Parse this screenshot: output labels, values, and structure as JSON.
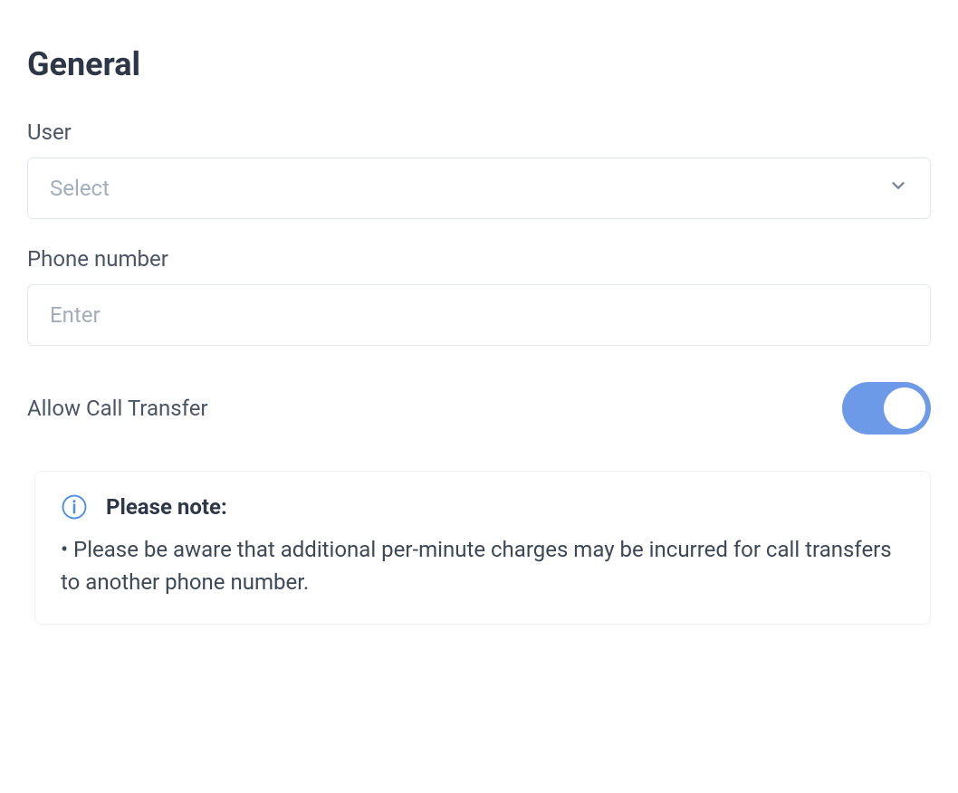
{
  "section": {
    "title": "General"
  },
  "fields": {
    "user": {
      "label": "User",
      "placeholder": "Select"
    },
    "phone": {
      "label": "Phone number",
      "placeholder": "Enter"
    },
    "transfer": {
      "label": "Allow Call Transfer",
      "enabled": true
    }
  },
  "note": {
    "title": "Please note:",
    "body": "• Please be aware that additional per-minute charges may be incurred for call transfers to another phone number."
  }
}
